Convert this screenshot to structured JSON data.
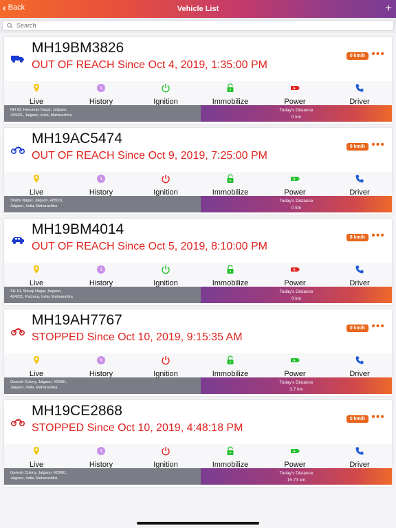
{
  "nav": {
    "back_label": "Back",
    "title": "Vehicle List",
    "add_icon": "plus-icon"
  },
  "search": {
    "placeholder": "Search"
  },
  "actions": [
    "Live",
    "History",
    "Ignition",
    "Immobilize",
    "Power",
    "Driver"
  ],
  "distance_label": "Today's Distance",
  "colors": {
    "status_red": "#e0221e",
    "speed_orange": "#e8661b",
    "live_yellow": "#f5c518",
    "history_purple": "#c98fe6",
    "ignition_green": "#22c12c",
    "ignition_red": "#e0221e",
    "immobilize_green": "#22c12c",
    "power_red": "#e0221e",
    "power_green": "#22c12c",
    "driver_blue": "#1e5bd8"
  },
  "vehicles": [
    {
      "plate": "MH19BM3826",
      "status": "OUT OF REACH Since Oct 4, 2019, 1:35:00 PM",
      "speed": "0 km/h",
      "type_icon": "truck-icon",
      "icon_color": "#1a3bd1",
      "ignition": "on",
      "power": "low",
      "address_line1": "NH 53, Hanuman Nagar, Jalgaon,",
      "address_line2": "425001, Jalgaon, India, Maharashtra",
      "distance": "0 km"
    },
    {
      "plate": "MH19AC5474",
      "status": "OUT OF REACH Since Oct 9, 2019, 7:25:00 PM",
      "speed": "0 km/h",
      "type_icon": "motorbike-icon",
      "icon_color": "#1a3bd1",
      "ignition": "off",
      "power": "ok",
      "address_line1": "Shahu Nagar, Jalgaon, 425001,",
      "address_line2": "Jalgaon, India, Maharashtra",
      "distance": "0 km"
    },
    {
      "plate": "MH19BM4014",
      "status": "OUT OF REACH Since Oct 5, 2019, 8:10:00 PM",
      "speed": "6 km/h",
      "type_icon": "car-icon",
      "icon_color": "#1a3bd1",
      "ignition": "on",
      "power": "low",
      "address_line1": "SH 19, Shivaji Nagar, Jalgaon,",
      "address_line2": "424201, Pachora, India, Maharashtra",
      "distance": "0 km"
    },
    {
      "plate": "MH19AH7767",
      "status": "STOPPED Since Oct 10, 2019, 9:15:35 AM",
      "speed": "0 km/h",
      "type_icon": "motorbike-icon",
      "icon_color": "#d0282a",
      "ignition": "off",
      "power": "ok",
      "address_line1": "Ganesh Colony, Jalgaon, 425001,",
      "address_line2": "Jalgaon, India, Maharashtra",
      "distance": "3.7 km"
    },
    {
      "plate": "MH19CE2868",
      "status": "STOPPED Since Oct 10, 2019, 4:48:18 PM",
      "speed": "0 km/h",
      "type_icon": "motorbike-icon",
      "icon_color": "#d0282a",
      "ignition": "off",
      "power": "ok",
      "address_line1": "Ganesh Colony, Jalgaon, 425001,",
      "address_line2": "Jalgaon, India, Maharashtra",
      "distance": "15.73 km"
    }
  ]
}
